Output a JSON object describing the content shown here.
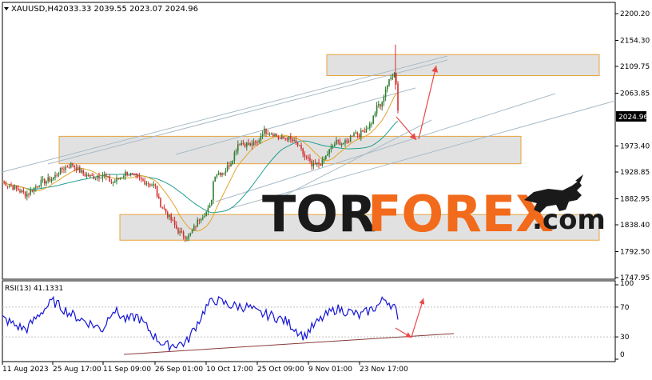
{
  "header": {
    "symbol": "XAUUSD,H4",
    "ohlc": "2033.33 2039.55 2023.07 2024.96"
  },
  "price_axis": {
    "ticks": [
      "2200.20",
      "2154.30",
      "2109.75",
      "2063.85",
      "2024.96",
      "1973.40",
      "1928.85",
      "1882.95",
      "1838.40",
      "1792.50",
      "1747.95"
    ],
    "current_price_label": "2024.96"
  },
  "rsi": {
    "title": "RSI(13) 41.1331",
    "ticks": [
      "100",
      "70",
      "30",
      "0"
    ]
  },
  "time_axis": {
    "ticks": [
      "11 Aug 2023",
      "25 Aug 17:00",
      "11 Sep 09:00",
      "26 Sep 01:00",
      "10 Oct 17:00",
      "25 Oct 09:00",
      "9 Nov 01:00",
      "23 Nov 17:00"
    ]
  },
  "watermark": {
    "part1": "TOR",
    "part2": "FOREX",
    "part3": ".com"
  },
  "colors": {
    "up_candle": "#2e7d32",
    "down_candle": "#d32f2f",
    "zone_fill": "#dcdcdc",
    "zone_border": "#e8a33c",
    "channel_line": "#a8bcc8",
    "ma_fast": "#e3a32a",
    "ma_slow": "#1f9e8f",
    "rsi_line": "#1515d6",
    "arrow": "#e8484a",
    "watermark_dark": "#1a1a1a",
    "watermark_orange": "#f26a1b"
  },
  "chart_data": {
    "type": "candlestick",
    "price_range": [
      1747.95,
      2200.2
    ],
    "close_path": [
      [
        "11 Aug 2023",
        1912
      ],
      [
        "15 Aug 2023",
        1900
      ],
      [
        "18 Aug 2023",
        1890
      ],
      [
        "22 Aug 2023",
        1910
      ],
      [
        "25 Aug 17:00",
        1918
      ],
      [
        "29 Aug 2023",
        1935
      ],
      [
        "1 Sep 2023",
        1942
      ],
      [
        "5 Sep 2023",
        1925
      ],
      [
        "8 Sep 2023",
        1920
      ],
      [
        "11 Sep 09:00",
        1924
      ],
      [
        "14 Sep 2023",
        1910
      ],
      [
        "18 Sep 2023",
        1928
      ],
      [
        "21 Sep 2023",
        1918
      ],
      [
        "26 Sep 01:00",
        1905
      ],
      [
        "27 Sep 2023",
        1880
      ],
      [
        "29 Sep 2023",
        1862
      ],
      [
        "3 Oct 2023",
        1825
      ],
      [
        "5 Oct 2023",
        1818
      ],
      [
        "6 Oct 2023",
        1820
      ],
      [
        "9 Oct 2023",
        1852
      ],
      [
        "10 Oct 17:00",
        1860
      ],
      [
        "12 Oct 2023",
        1870
      ],
      [
        "13 Oct 2023",
        1925
      ],
      [
        "16 Oct 2023",
        1930
      ],
      [
        "18 Oct 2023",
        1948
      ],
      [
        "20 Oct 2023",
        1980
      ],
      [
        "23 Oct 2023",
        1975
      ],
      [
        "25 Oct 09:00",
        1978
      ],
      [
        "27 Oct 2023",
        2000
      ],
      [
        "30 Oct 2023",
        1995
      ],
      [
        "1 Nov 2023",
        1985
      ],
      [
        "3 Nov 2023",
        1988
      ],
      [
        "6 Nov 2023",
        1975
      ],
      [
        "8 Nov 2023",
        1955
      ],
      [
        "9 Nov 01:00",
        1950
      ],
      [
        "10 Nov 2023",
        1938
      ],
      [
        "13 Nov 2023",
        1945
      ],
      [
        "15 Nov 2023",
        1965
      ],
      [
        "17 Nov 2023",
        1980
      ],
      [
        "20 Nov 2023",
        1978
      ],
      [
        "22 Nov 2023",
        1998
      ],
      [
        "23 Nov 17:00",
        1993
      ],
      [
        "27 Nov 2023",
        2012
      ],
      [
        "29 Nov 2023",
        2045
      ],
      [
        "30 Nov 2023",
        2040
      ],
      [
        "1 Dec 2023",
        2070
      ],
      [
        "4 Dec 2023",
        2105
      ],
      [
        "4 Dec 2023 12:00",
        2045
      ],
      [
        "5 Dec 2023",
        2024.96
      ]
    ],
    "rsi_path": [
      [
        "11 Aug 2023",
        55
      ],
      [
        "15 Aug 2023",
        45
      ],
      [
        "18 Aug 2023",
        40
      ],
      [
        "22 Aug 2023",
        62
      ],
      [
        "25 Aug 17:00",
        78
      ],
      [
        "1 Sep 2023",
        60
      ],
      [
        "5 Sep 2023",
        52
      ],
      [
        "11 Sep 09:00",
        40
      ],
      [
        "14 Sep 2023",
        68
      ],
      [
        "18 Sep 2023",
        52
      ],
      [
        "21 Sep 2023",
        58
      ],
      [
        "26 Sep 01:00",
        30
      ],
      [
        "29 Sep 2023",
        18
      ],
      [
        "5 Oct 2023",
        22
      ],
      [
        "9 Oct 2023",
        55
      ],
      [
        "10 Oct 17:00",
        70
      ],
      [
        "13 Oct 2023",
        80
      ],
      [
        "18 Oct 2023",
        72
      ],
      [
        "23 Oct 2023",
        70
      ],
      [
        "25 Oct 09:00",
        62
      ],
      [
        "30 Oct 2023",
        58
      ],
      [
        "3 Nov 2023",
        50
      ],
      [
        "8 Nov 2023",
        30
      ],
      [
        "9 Nov 01:00",
        38
      ],
      [
        "13 Nov 2023",
        55
      ],
      [
        "17 Nov 2023",
        68
      ],
      [
        "22 Nov 2023",
        62
      ],
      [
        "23 Nov 17:00",
        58
      ],
      [
        "29 Nov 2023",
        72
      ],
      [
        "1 Dec 2023",
        82
      ],
      [
        "4 Dec 2023",
        68
      ],
      [
        "5 Dec 2023",
        41.13
      ]
    ],
    "zones": [
      {
        "name": "resistance zone",
        "low": 2094,
        "high": 2130
      },
      {
        "name": "middle zone",
        "low": 1943,
        "high": 1990
      },
      {
        "name": "support zone",
        "low": 1812,
        "high": 1856
      }
    ],
    "current_price": 2024.96,
    "rsi_value": 41.1331,
    "rsi_levels": [
      70,
      30
    ]
  }
}
